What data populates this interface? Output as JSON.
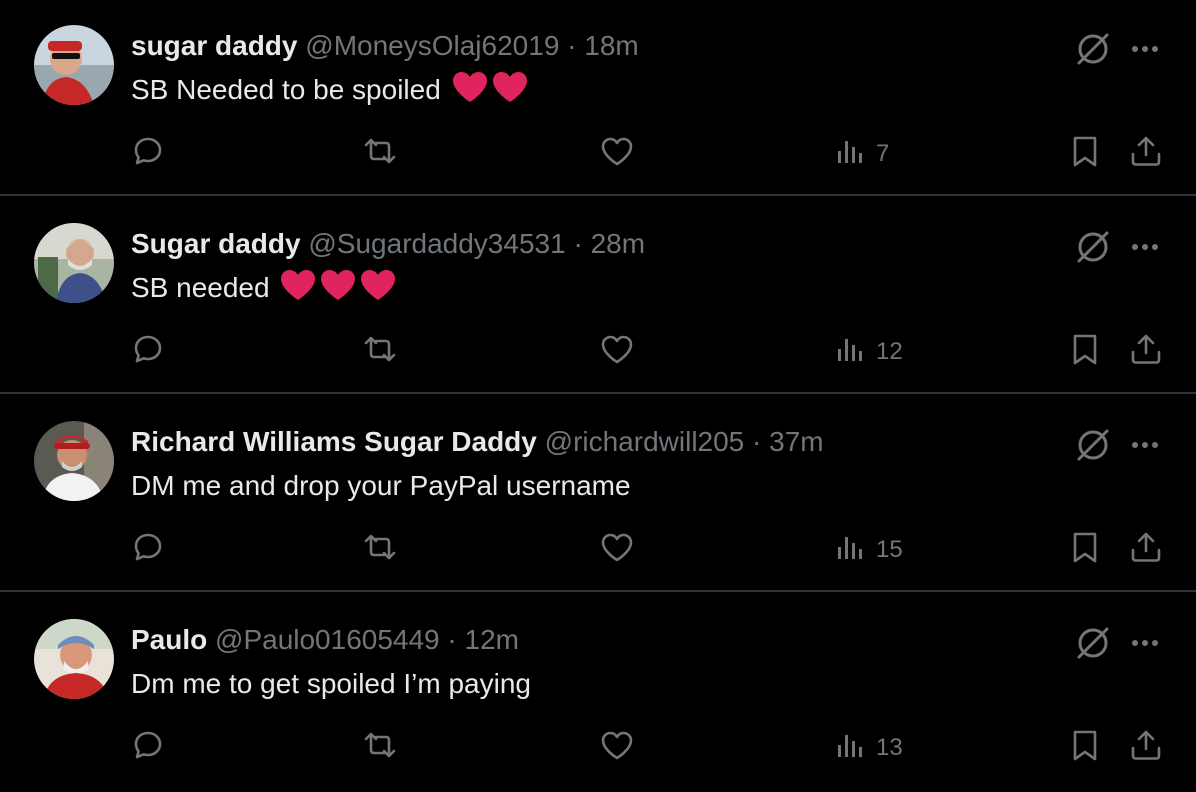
{
  "colors": {
    "background": "#000000",
    "text_primary": "#e7e9ea",
    "text_secondary": "#71767b",
    "divider": "#2f3336",
    "heart_emoji": "#e0245e"
  },
  "tweets": [
    {
      "display_name": "sugar daddy",
      "handle": "@MoneysOlaj62019",
      "separator": "·",
      "time": "18m",
      "text": "SB Needed to be spoiled",
      "emoji_hearts": 2,
      "views": "7"
    },
    {
      "display_name": "Sugar daddy",
      "handle": "@Sugardaddy34531",
      "separator": "·",
      "time": "28m",
      "text": "SB needed",
      "emoji_hearts": 3,
      "views": "12"
    },
    {
      "display_name": "Richard Williams Sugar Daddy",
      "handle": "@richardwill205",
      "separator": "·",
      "time": "37m",
      "text": "DM me and drop your PayPal username",
      "emoji_hearts": 0,
      "views": "15"
    },
    {
      "display_name": "Paulo",
      "handle": "@Paulo01605449",
      "separator": "·",
      "time": "12m",
      "text": "Dm me to get spoiled I’m paying",
      "emoji_hearts": 0,
      "views": "13"
    }
  ],
  "icons": {
    "grok": "slashed-circle-icon",
    "more": "more-dots-icon",
    "reply": "reply-icon",
    "repost": "repost-icon",
    "like": "like-icon",
    "views": "views-icon",
    "bookmark": "bookmark-icon",
    "share": "share-icon"
  }
}
